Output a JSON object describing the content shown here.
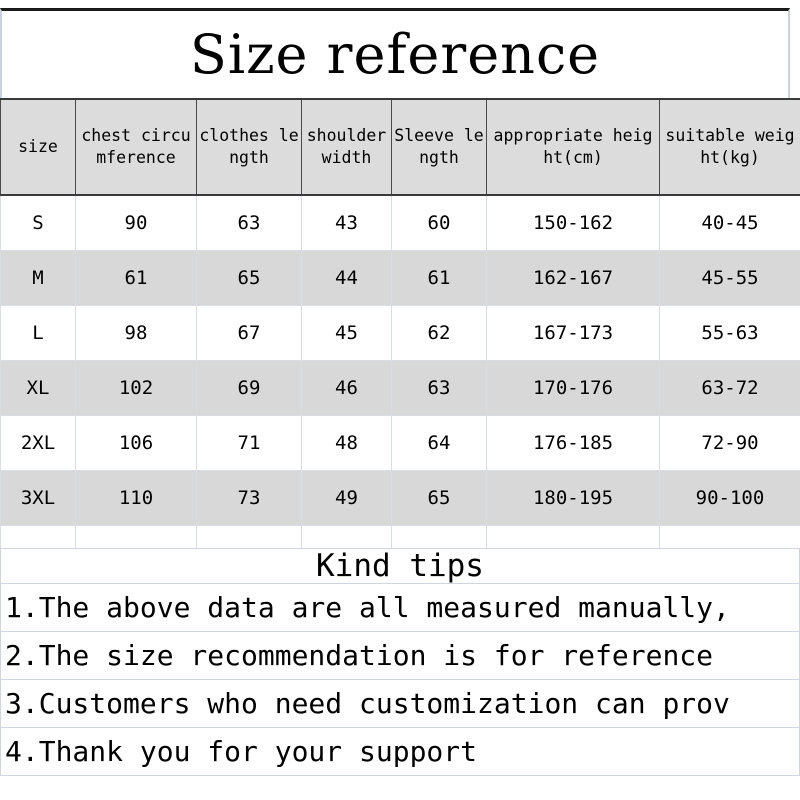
{
  "title": "Size reference",
  "table": {
    "headers": [
      "size",
      "chest circumference",
      "clothes length",
      "shoulder width",
      "Sleeve length",
      "appropriate height(cm)",
      "suitable weight(kg)"
    ],
    "rows": [
      {
        "size": "S",
        "chest": "90",
        "length": "63",
        "shoulder": "43",
        "sleeve": "60",
        "height": "150-162",
        "weight": "40-45"
      },
      {
        "size": "M",
        "chest": "61",
        "length": "65",
        "shoulder": "44",
        "sleeve": "61",
        "height": "162-167",
        "weight": "45-55"
      },
      {
        "size": "L",
        "chest": "98",
        "length": "67",
        "shoulder": "45",
        "sleeve": "62",
        "height": "167-173",
        "weight": "55-63"
      },
      {
        "size": "XL",
        "chest": "102",
        "length": "69",
        "shoulder": "46",
        "sleeve": "63",
        "height": "170-176",
        "weight": "63-72"
      },
      {
        "size": "2XL",
        "chest": "106",
        "length": "71",
        "shoulder": "48",
        "sleeve": "64",
        "height": "176-185",
        "weight": "72-90"
      },
      {
        "size": "3XL",
        "chest": "110",
        "length": "73",
        "shoulder": "49",
        "sleeve": "65",
        "height": "180-195",
        "weight": "90-100"
      }
    ]
  },
  "tips": {
    "heading": "Kind tips",
    "lines": [
      "1.The above data are all measured manually,",
      "2.The size recommendation is for reference",
      "3.Customers who need customization can prov",
      "4.Thank you for your support"
    ]
  },
  "colors": {
    "header_background": "#dcdcdc",
    "shaded_row_background": "#d8d8d8",
    "plain_row_background": "#ffffff",
    "grid_border": "#4a4a4a",
    "light_border": "#cdd5e4",
    "text": "#000000"
  }
}
